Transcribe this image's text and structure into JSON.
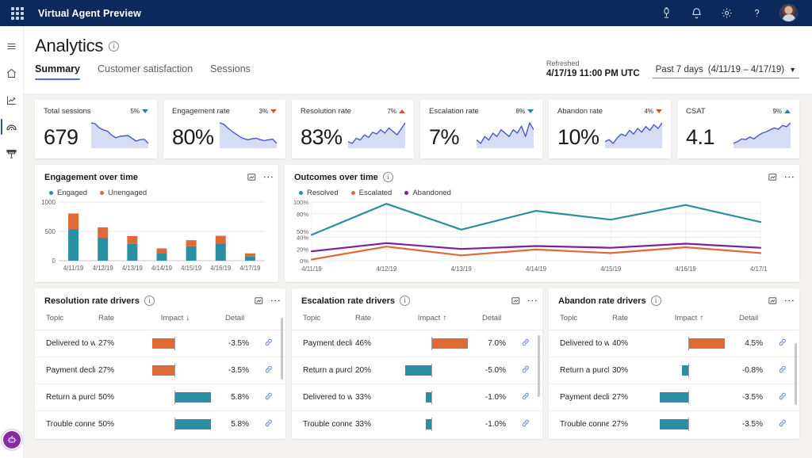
{
  "suite": {
    "title": "Virtual Agent Preview",
    "waffle_icon": "app-launcher-waffle-icon",
    "icons": [
      {
        "name": "megaphone-icon",
        "label": "Feedback"
      },
      {
        "name": "bell-icon",
        "label": "Notifications"
      },
      {
        "name": "gear-icon",
        "label": "Settings"
      },
      {
        "name": "help-icon",
        "label": "Help"
      }
    ],
    "avatar_label": "Account manager"
  },
  "rail": {
    "items": [
      {
        "name": "hamburger-icon",
        "label": "Menu"
      },
      {
        "name": "home-icon",
        "label": "Home"
      },
      {
        "name": "analytics-chart-icon",
        "label": "Analytics"
      },
      {
        "name": "virtual-agent-icon",
        "label": "Virtual agent",
        "selected": true
      },
      {
        "name": "topics-icon",
        "label": "Topics"
      }
    ],
    "bot_button_label": "Bot assistant"
  },
  "header": {
    "page_title": "Analytics",
    "info_glyph": "i",
    "tabs": [
      {
        "label": "Summary",
        "active": true
      },
      {
        "label": "Customer satisfaction",
        "active": false
      },
      {
        "label": "Sessions",
        "active": false
      }
    ],
    "refreshed_label": "Refreshed",
    "refreshed_value": "4/17/19 11:00 PM UTC",
    "range_label": "Past 7 days",
    "range_dates": "(4/11/19 – 4/17/19)",
    "range_chevron": "chevron-down-icon"
  },
  "kpis": [
    {
      "name": "Total sessions",
      "value": "679",
      "delta": "5%",
      "direction": "down",
      "delta_color": "#1f8a9c",
      "spark": [
        62,
        60,
        51,
        47,
        44,
        36,
        30,
        33,
        34,
        35,
        29,
        23,
        26,
        27,
        18
      ],
      "line_color": "#4559c9",
      "fill_color": "#d7dcf5"
    },
    {
      "name": "Engagement rate",
      "value": "80%",
      "delta": "3%",
      "direction": "down",
      "delta_color": "#d9542b",
      "spark": [
        58,
        55,
        47,
        40,
        34,
        28,
        24,
        22,
        24,
        25,
        22,
        20,
        22,
        23,
        14
      ],
      "line_color": "#4559c9",
      "fill_color": "#d7dcf5"
    },
    {
      "name": "Resolution rate",
      "value": "83%",
      "delta": "7%",
      "direction": "up",
      "delta_color": "#d9542b",
      "spark": [
        22,
        20,
        26,
        24,
        30,
        27,
        33,
        31,
        36,
        32,
        38,
        34,
        30,
        37,
        44
      ],
      "line_color": "#4559c9",
      "fill_color": "#d7dcf5"
    },
    {
      "name": "Escalation rate",
      "value": "7%",
      "delta": "8%",
      "direction": "down",
      "delta_color": "#1f8a9c",
      "spark": [
        18,
        17,
        19,
        18,
        20,
        19,
        21,
        20,
        19,
        21,
        20,
        22,
        19,
        23,
        21
      ],
      "line_color": "#4559c9",
      "fill_color": "#d7dcf5"
    },
    {
      "name": "Abandon rate",
      "value": "10%",
      "delta": "4%",
      "direction": "down",
      "delta_color": "#d9542b",
      "spark": [
        14,
        15,
        13,
        16,
        18,
        17,
        20,
        18,
        21,
        19,
        22,
        20,
        23,
        21,
        24
      ],
      "line_color": "#4559c9",
      "fill_color": "#d7dcf5"
    },
    {
      "name": "CSAT",
      "value": "4.1",
      "delta": "9%",
      "direction": "up",
      "delta_color": "#1f8a9c",
      "spark": [
        10,
        13,
        17,
        16,
        20,
        17,
        22,
        26,
        28,
        31,
        34,
        32,
        38,
        36,
        42
      ],
      "line_color": "#4559c9",
      "fill_color": "#d7dcf5"
    }
  ],
  "engagement_card": {
    "title": "Engagement over time",
    "expand_icon": "popout-icon",
    "more_icon": "more-vertical-icon",
    "legend": [
      {
        "label": "Engaged",
        "color": "#2b8fa3"
      },
      {
        "label": "Unengaged",
        "color": "#de6a35"
      }
    ]
  },
  "outcomes_card": {
    "title": "Outcomes over time",
    "info_glyph": "i",
    "expand_icon": "popout-icon",
    "more_icon": "more-vertical-icon",
    "legend": [
      {
        "label": "Resolved",
        "color": "#2b8fa3"
      },
      {
        "label": "Escalated",
        "color": "#de6a35"
      },
      {
        "label": "Abandoned",
        "color": "#7b1fa2"
      }
    ]
  },
  "chart_data": [
    {
      "type": "bar",
      "title": "Engagement over time",
      "stacked": true,
      "categories": [
        "4/11/19",
        "4/12/19",
        "4/13/19",
        "4/14/19",
        "4/15/19",
        "4/16/19",
        "4/17/19"
      ],
      "series": [
        {
          "name": "Engaged",
          "color": "#2b8fa3",
          "values": [
            540,
            385,
            285,
            130,
            245,
            290,
            70
          ]
        },
        {
          "name": "Unengaged",
          "color": "#de6a35",
          "values": [
            265,
            185,
            135,
            80,
            105,
            135,
            55
          ]
        }
      ],
      "xlabel": "",
      "ylabel": "",
      "ylim": [
        0,
        1000
      ],
      "yticks": [
        0,
        500,
        1000
      ],
      "ytick_labels": [
        "0",
        "500",
        "1000"
      ],
      "grid": true,
      "legend_position": "top-left"
    },
    {
      "type": "line",
      "title": "Outcomes over time",
      "x": [
        "4/11/19",
        "4/12/19",
        "4/13/19",
        "4/14/19",
        "4/15/19",
        "4/16/19",
        "4/17/19"
      ],
      "series": [
        {
          "name": "Resolved",
          "color": "#2b8fa3",
          "values": [
            44,
            97,
            53,
            85,
            70,
            95,
            66
          ]
        },
        {
          "name": "Escalated",
          "color": "#de6a35",
          "values": [
            2,
            24,
            9,
            19,
            13,
            23,
            13
          ]
        },
        {
          "name": "Abandoned",
          "color": "#7b1fa2",
          "values": [
            16,
            30,
            20,
            25,
            22,
            29,
            22
          ]
        }
      ],
      "xlabel": "",
      "ylabel": "",
      "ylim": [
        0,
        100
      ],
      "yticks": [
        0,
        20,
        40,
        50,
        80,
        100
      ],
      "ytick_labels": [
        "0%",
        "20%",
        "40%",
        "50%",
        "80%",
        "100%"
      ],
      "grid": true,
      "legend_position": "top-left"
    }
  ],
  "driver_tables": [
    {
      "title": "Resolution rate drivers",
      "info_glyph": "i",
      "expand_icon": "popout-icon",
      "more_icon": "more-vertical-icon",
      "columns": [
        "Topic",
        "Rate",
        "Impact",
        "Detail"
      ],
      "sort_column": "Impact",
      "sort_direction": "down",
      "sort_arrow": "↓",
      "rows": [
        {
          "topic": "Delivered to wron…",
          "rate": "27%",
          "impact": "-3.5%",
          "impact_value": -3.5,
          "bar_color": "#de6a35",
          "detail_icon": "link-icon"
        },
        {
          "topic": "Payment declined",
          "rate": "27%",
          "impact": "-3.5%",
          "impact_value": -3.5,
          "bar_color": "#de6a35",
          "detail_icon": "link-icon"
        },
        {
          "topic": "Return a purchase",
          "rate": "50%",
          "impact": "5.8%",
          "impact_value": 5.8,
          "bar_color": "#2b8fa3",
          "detail_icon": "link-icon"
        },
        {
          "topic": "Trouble connecting",
          "rate": "50%",
          "impact": "5.8%",
          "impact_value": 5.8,
          "bar_color": "#2b8fa3",
          "detail_icon": "link-icon"
        }
      ]
    },
    {
      "title": "Escalation rate drivers",
      "info_glyph": "i",
      "expand_icon": "popout-icon",
      "more_icon": "more-vertical-icon",
      "columns": [
        "Topic",
        "Rate",
        "Impact",
        "Detail"
      ],
      "sort_column": "Impact",
      "sort_direction": "up",
      "sort_arrow": "↑",
      "rows": [
        {
          "topic": "Payment declined",
          "rate": "46%",
          "impact": "7.0%",
          "impact_value": 7.0,
          "bar_color": "#de6a35",
          "detail_icon": "link-icon"
        },
        {
          "topic": "Return a purchase",
          "rate": "20%",
          "impact": "-5.0%",
          "impact_value": -5.0,
          "bar_color": "#2b8fa3",
          "detail_icon": "link-icon"
        },
        {
          "topic": "Delivered to wron…",
          "rate": "33%",
          "impact": "-1.0%",
          "impact_value": -1.0,
          "bar_color": "#2b8fa3",
          "detail_icon": "link-icon"
        },
        {
          "topic": "Trouble connecting",
          "rate": "33%",
          "impact": "-1.0%",
          "impact_value": -1.0,
          "bar_color": "#2b8fa3",
          "detail_icon": "link-icon"
        }
      ]
    },
    {
      "title": "Abandon rate drivers",
      "info_glyph": "i",
      "expand_icon": "popout-icon",
      "more_icon": "more-vertical-icon",
      "columns": [
        "Topic",
        "Rate",
        "Impact",
        "Detail"
      ],
      "sort_column": "Impact",
      "sort_direction": "up",
      "sort_arrow": "↑",
      "rows": [
        {
          "topic": "Delivered to wron…",
          "rate": "40%",
          "impact": "4.5%",
          "impact_value": 4.5,
          "bar_color": "#de6a35",
          "detail_icon": "link-icon"
        },
        {
          "topic": "Return a purchase",
          "rate": "30%",
          "impact": "-0.8%",
          "impact_value": -0.8,
          "bar_color": "#2b8fa3",
          "detail_icon": "link-icon"
        },
        {
          "topic": "Payment declined",
          "rate": "27%",
          "impact": "-3.5%",
          "impact_value": -3.5,
          "bar_color": "#2b8fa3",
          "detail_icon": "link-icon"
        },
        {
          "topic": "Trouble connecting",
          "rate": "27%",
          "impact": "-3.5%",
          "impact_value": -3.5,
          "bar_color": "#2b8fa3",
          "detail_icon": "link-icon"
        }
      ]
    }
  ]
}
